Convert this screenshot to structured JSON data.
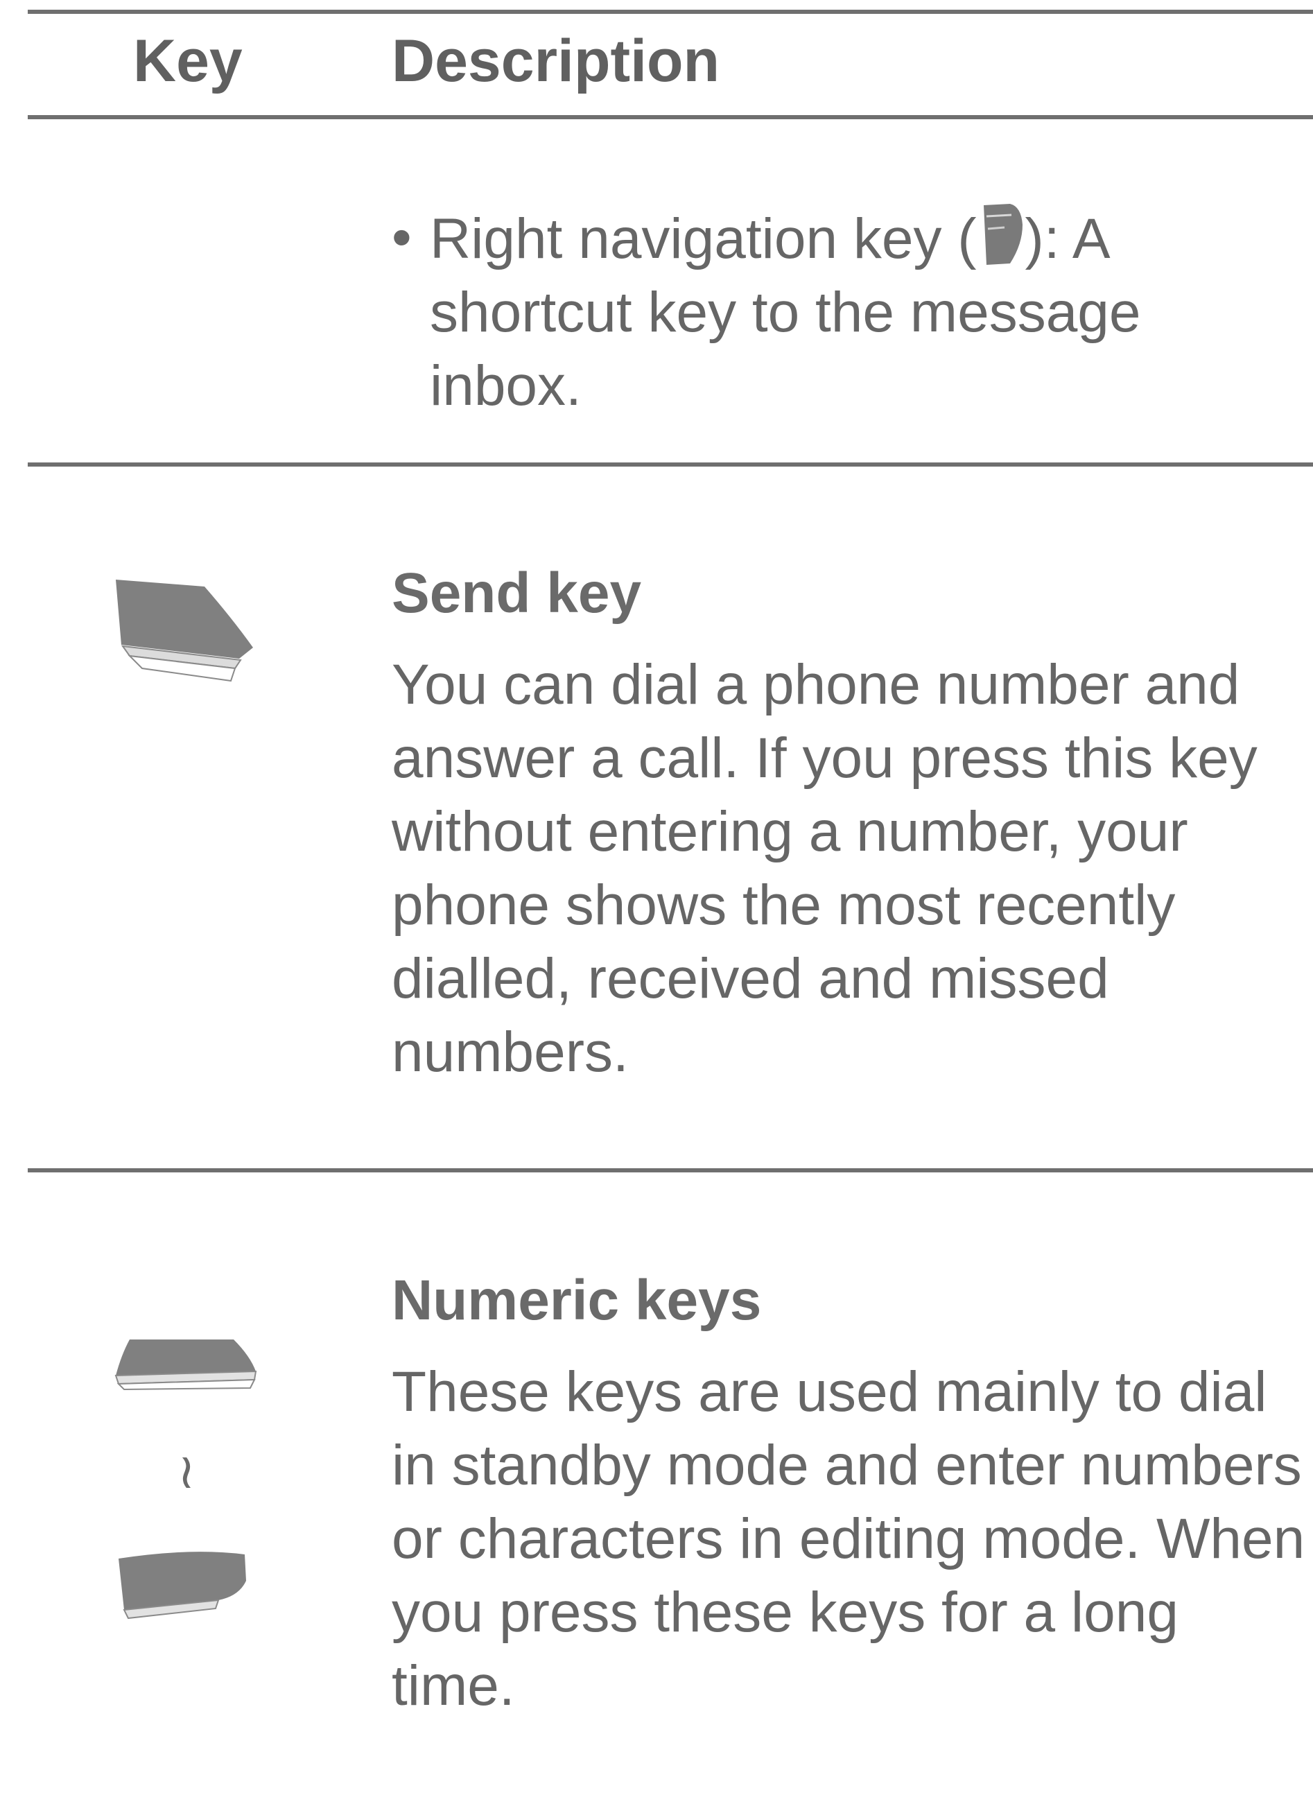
{
  "header": {
    "key_label": "Key",
    "description_label": "Description"
  },
  "rows": [
    {
      "bullet": "•",
      "text_before": "Right navigation key (",
      "icon": "right-navigation-key-icon",
      "text_after": "): A shortcut key to the message inbox."
    },
    {
      "icon": "send-key-icon",
      "title": "Send key",
      "body": "You can dial a phone number and answer a call. If you press this key without entering a number, your phone shows the most recently dialled, received and missed numbers."
    },
    {
      "icon": "numeric-keys-icon",
      "range_glyph": "≀",
      "title": "Numeric keys",
      "body": "These keys are used mainly to dial in standby mode and enter numbers or characters in editing mode. When you press these keys for a long time."
    }
  ],
  "colors": {
    "rule": "#6f6f6f",
    "text": "#666666",
    "key_fill": "#808080"
  }
}
